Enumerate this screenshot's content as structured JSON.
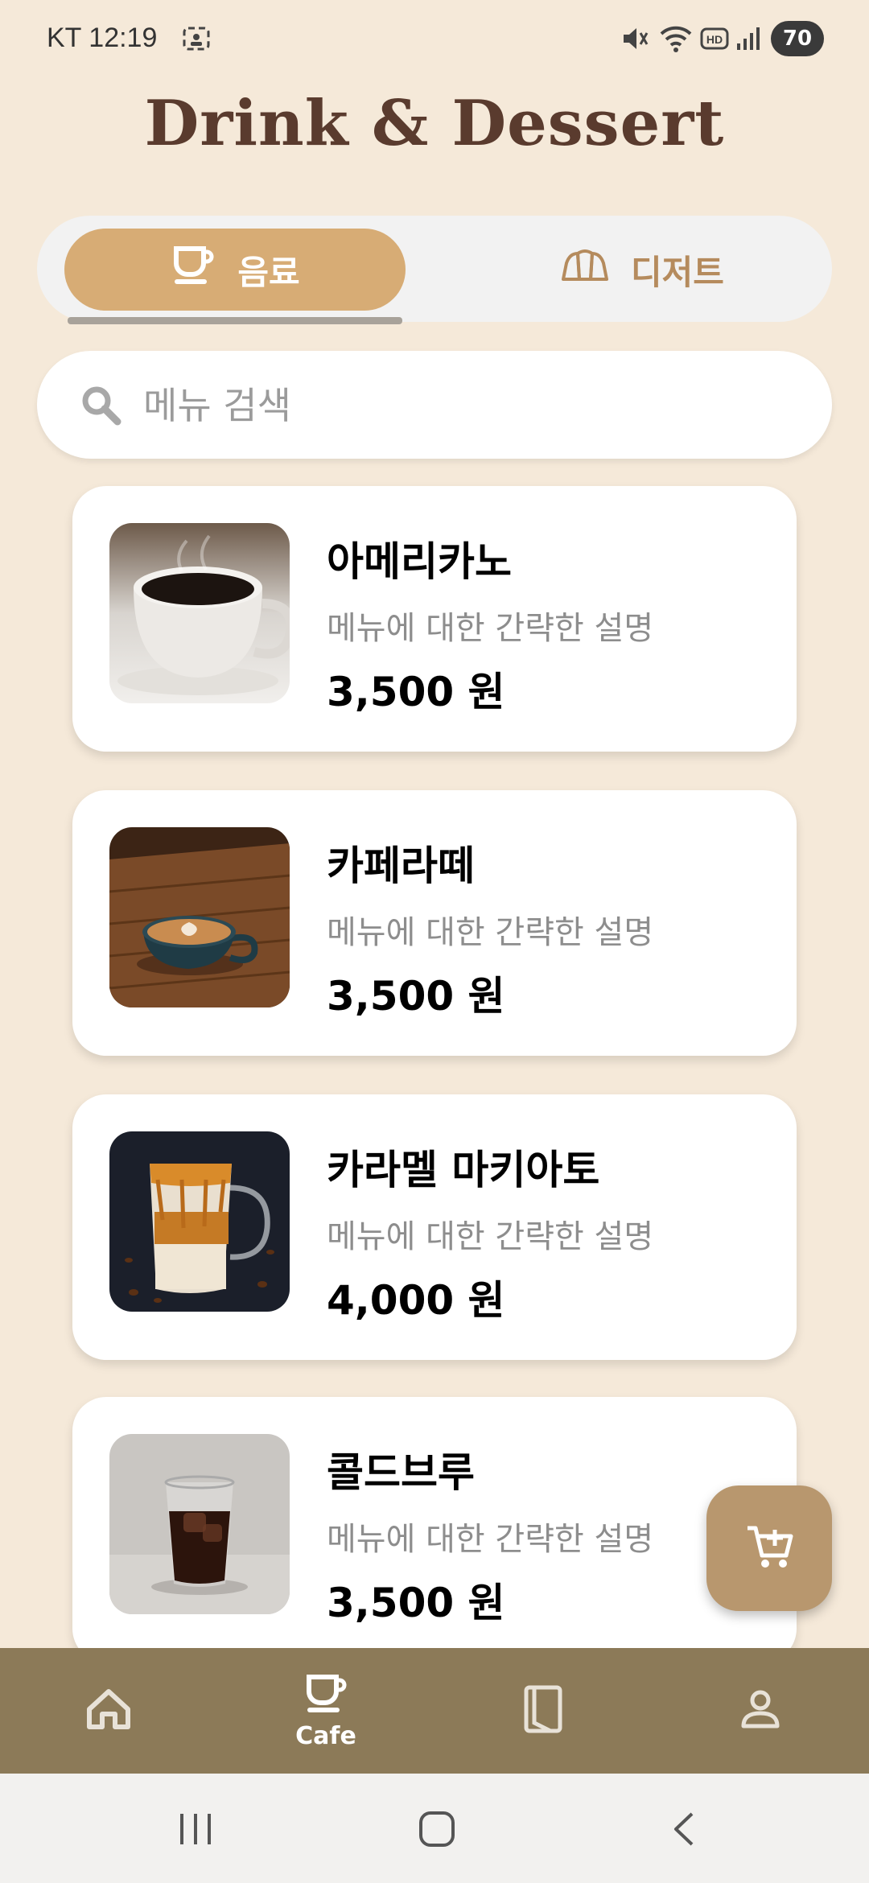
{
  "status_bar": {
    "time": "KT 12:19",
    "battery": "70",
    "icons": [
      "screenshot-icon",
      "mute-icon",
      "wifi-icon",
      "hd-icon",
      "signal-icon",
      "battery-icon"
    ]
  },
  "app_title": "Drink & Dessert",
  "tabs": [
    {
      "label": "음료",
      "icon": "coffee-cup-icon",
      "selected": true
    },
    {
      "label": "디저트",
      "icon": "croissant-icon",
      "selected": false
    }
  ],
  "search": {
    "placeholder": "메뉴 검색",
    "value": ""
  },
  "menu_items": [
    {
      "name": "아메리카노",
      "description": "메뉴에 대한 간략한 설명",
      "price": "3,500 원"
    },
    {
      "name": "카페라떼",
      "description": "메뉴에 대한 간략한 설명",
      "price": "3,500 원"
    },
    {
      "name": "카라멜 마키아토",
      "description": "메뉴에 대한 간략한 설명",
      "price": "4,000 원"
    },
    {
      "name": "콜드브루",
      "description": "메뉴에 대한 간략한 설명",
      "price": "3,500 원"
    }
  ],
  "fab": {
    "icon": "cart-add-icon"
  },
  "bottom_nav": [
    {
      "icon": "home-icon",
      "label": ""
    },
    {
      "icon": "coffee-cup-icon",
      "label": "Cafe",
      "selected": true
    },
    {
      "icon": "book-icon",
      "label": ""
    },
    {
      "icon": "profile-icon",
      "label": ""
    }
  ],
  "colors": {
    "background": "#f5e9d9",
    "accent": "#d7ac75",
    "title": "#5a3b2e",
    "nav_bar": "#8c7a58",
    "fab": "#b8976e"
  }
}
